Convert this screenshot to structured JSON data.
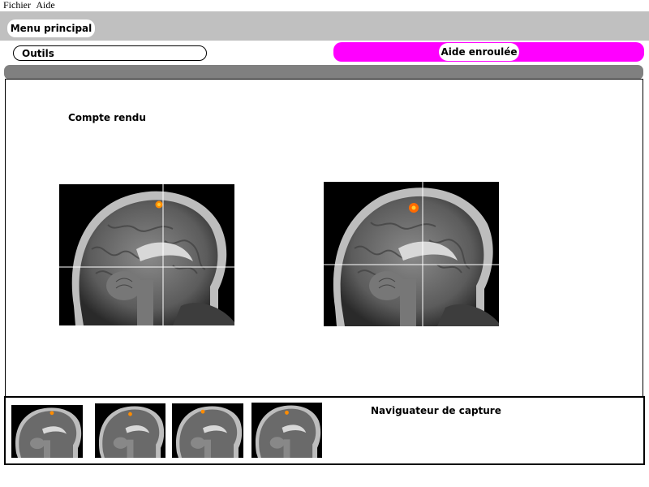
{
  "menubar": {
    "items": [
      "Fichier",
      "Aide"
    ]
  },
  "toolbar": {
    "main_menu_label": "Menu principal",
    "tools_label": "Outils",
    "help_label": "Aide enroulée"
  },
  "main": {
    "report_label": "Compte rendu"
  },
  "navigator": {
    "label": "Naviguateur de capture",
    "thumbnail_count": 4
  },
  "colors": {
    "toolbar_bg": "#c0c0c0",
    "help_bar": "#ff00ff",
    "separator_bar": "#808080",
    "activation": "#ff8c00"
  }
}
